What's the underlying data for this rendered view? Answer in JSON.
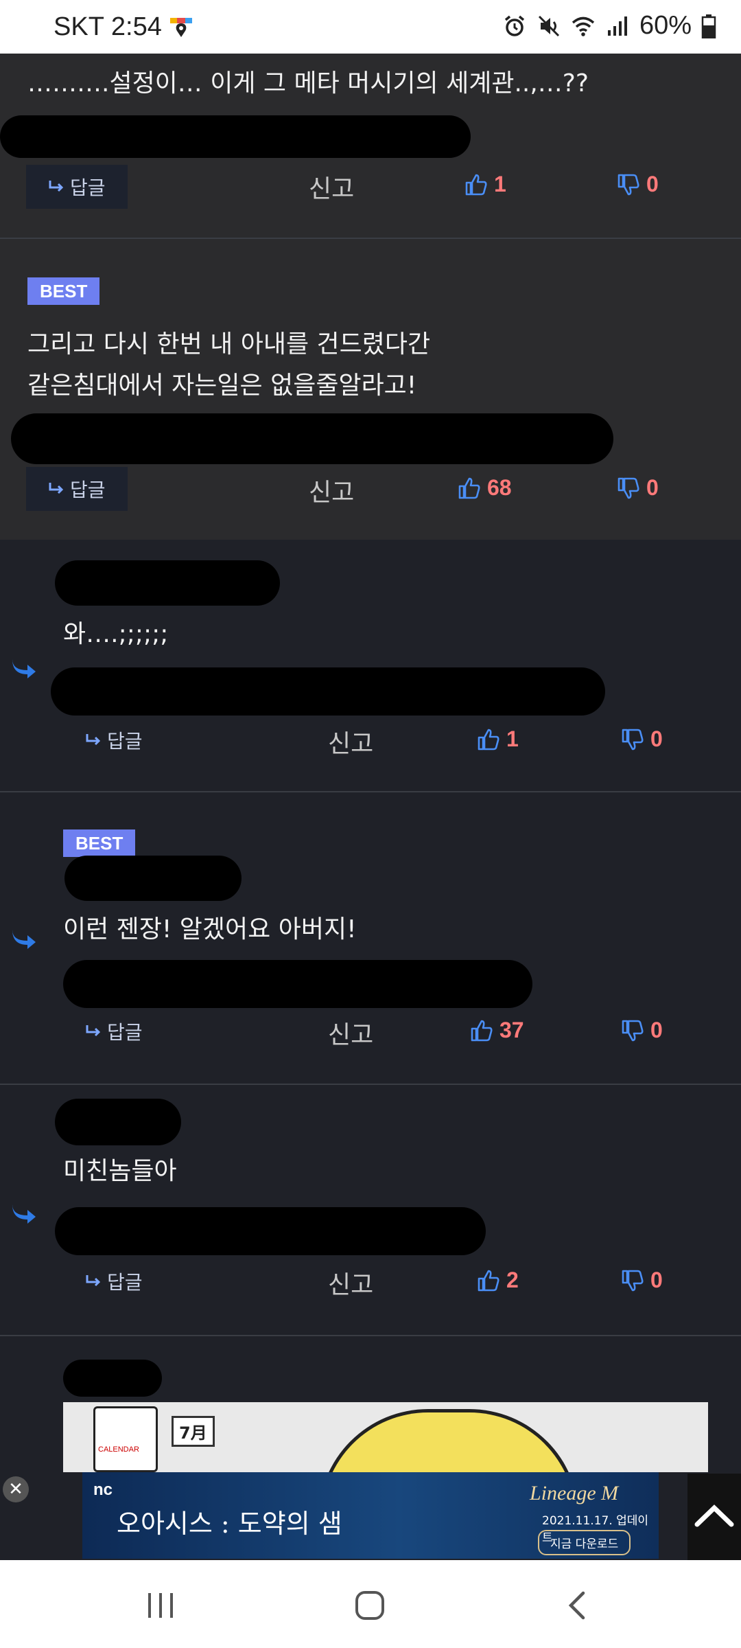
{
  "status": {
    "carrier": "SKT",
    "time": "2:54",
    "battery": "60%"
  },
  "comments": [
    {
      "best": "",
      "text": "……….설정이… 이게 그 메타 머시기의 세계관..,…??",
      "reply_label": "답글",
      "report_label": "신고",
      "likes": "1",
      "dislikes": "0"
    },
    {
      "best": "BEST",
      "text": "그리고 다시 한번 내 아내를 건드렸다간\n같은침대에서 자는일은 없을줄알라고!",
      "reply_label": "답글",
      "report_label": "신고",
      "likes": "68",
      "dislikes": "0"
    },
    {
      "best": "",
      "text": "와….;;;;;;",
      "reply_label": "답글",
      "report_label": "신고",
      "likes": "1",
      "dislikes": "0"
    },
    {
      "best": "BEST",
      "text": "이런 젠장! 알겠어요 아버지!",
      "reply_label": "답글",
      "report_label": "신고",
      "likes": "37",
      "dislikes": "0"
    },
    {
      "best": "",
      "text": "미친놈들아",
      "reply_label": "답글",
      "report_label": "신고",
      "likes": "2",
      "dislikes": "0"
    }
  ],
  "ad": {
    "brand": "nc",
    "title": "오아시스 : 도약의 샘",
    "game_logo": "Lineage M",
    "date": "2021.11.17. 업데이트",
    "cta": "지금 다운로드",
    "image_month": "7月",
    "image_calendar": "CALENDAR"
  },
  "colors": {
    "best_badge": "#6e7ff0",
    "like_count": "#ff7a7a",
    "thumb_icon": "#4a8ef5",
    "reply_arrow": "#2f7be6"
  }
}
